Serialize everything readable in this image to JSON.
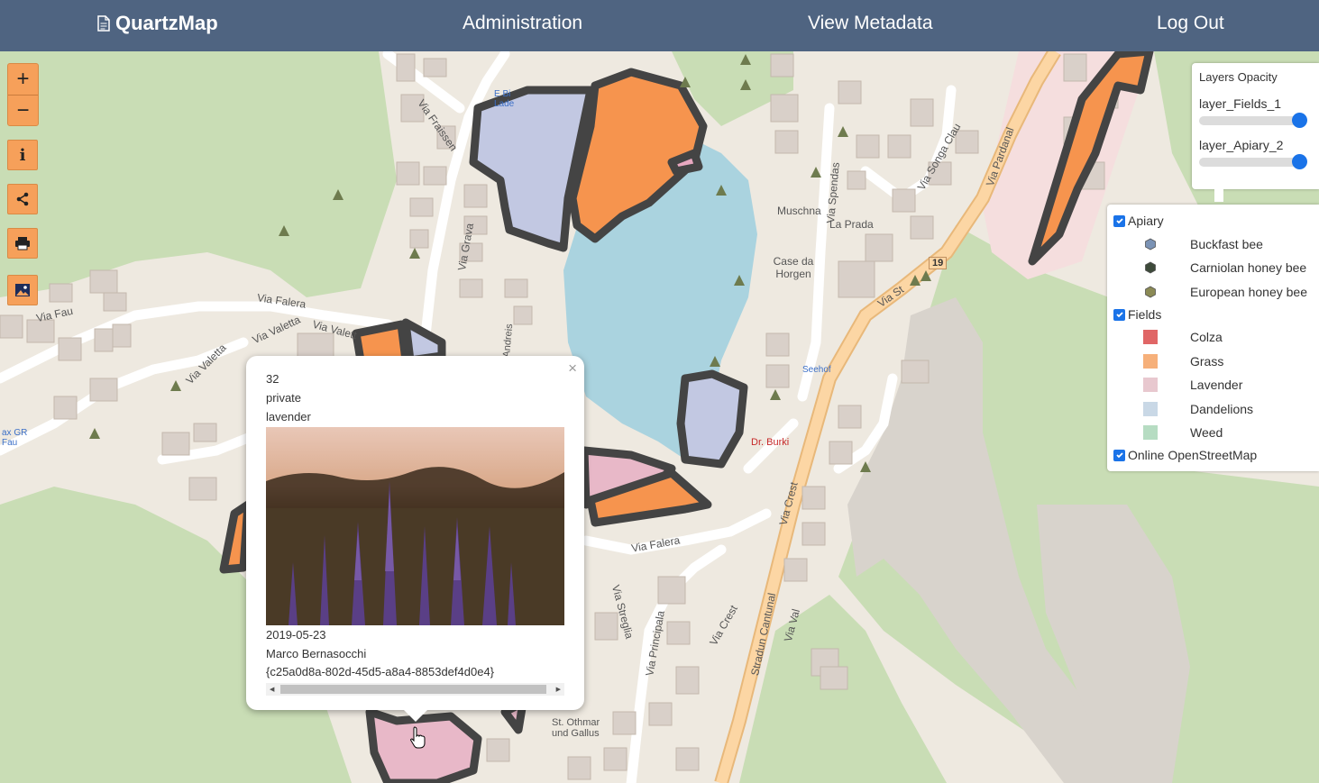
{
  "nav": {
    "brand": "QuartzMap",
    "administration": "Administration",
    "view_metadata": "View Metadata",
    "log_out": "Log Out"
  },
  "controls": {
    "zoom_in": "+",
    "zoom_out": "−",
    "info_icon": "i"
  },
  "opacity_panel": {
    "title": "Layers Opacity",
    "layers": [
      {
        "label": "layer_Fields_1",
        "value": 100
      },
      {
        "label": "layer_Apiary_2",
        "value": 100
      }
    ]
  },
  "legend": {
    "apiary": {
      "label": "Apiary",
      "items": [
        {
          "label": "Buckfast bee",
          "color": "#7b93b5"
        },
        {
          "label": "Carniolan honey bee",
          "color": "#3d4a3a"
        },
        {
          "label": "European honey bee",
          "color": "#8b8a55"
        }
      ]
    },
    "fields": {
      "label": "Fields",
      "items": [
        {
          "label": "Colza",
          "color": "#e06666"
        },
        {
          "label": "Grass",
          "color": "#f6b07a"
        },
        {
          "label": "Lavender",
          "color": "#e8c8cf"
        },
        {
          "label": "Dandelions",
          "color": "#c9d8e6"
        },
        {
          "label": "Weed",
          "color": "#b6dcc2"
        }
      ]
    },
    "osm": {
      "label": "Online OpenStreetMap"
    }
  },
  "popup": {
    "id": "32",
    "status": "private",
    "crop": "lavender",
    "date": "2019-05-23",
    "author": "Marco Bernasocchi",
    "uuid": "{c25a0d8a-802d-45d5-a8a4-8853def4d0e4}",
    "close": "×"
  },
  "map_labels": {
    "via_fraissen": "Via Fraissen",
    "via_grava": "Via Grava",
    "via_falera": "Via Falera",
    "via_falera_2": "Via Falera",
    "via_fau": "Via Fau",
    "via_valetta": "Via Valetta",
    "via_valetta_2": "Via Valetta",
    "via_valetta_3": "Via Valett",
    "via_spendas": "Via Spendas",
    "via_songa_clau": "Via Songa Clau",
    "via_pardanal": "Via Pardanal",
    "via_crest": "Via Crest",
    "via_crest_2": "Via Crest",
    "via_principala": "Via Principala",
    "via_streglia": "Via Streglia",
    "stradun_cantunal": "Stradun Cantunal",
    "via_val": "Via Val",
    "via_s": "Via St",
    "muschna": "Muschna",
    "la_prada": "La Prada",
    "case_da_horgen": "Case da Horgen",
    "dr_burki": "Dr. Burki",
    "seehof": "Seehof",
    "st_othmar": "St. Othmar und Gallus",
    "road_19": "19",
    "andreis": "Andreis",
    "lade": "E Bi Lade",
    "bus": "ax GR Fau"
  }
}
